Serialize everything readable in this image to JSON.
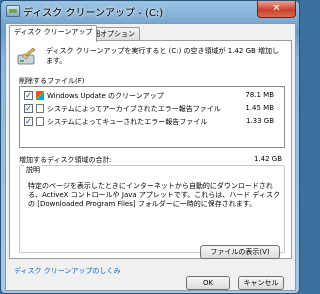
{
  "window": {
    "title": "ディスク クリーンアップ - (C:)",
    "close_glyph": "✕"
  },
  "tabs": [
    {
      "label": "ディスク クリーンアップ"
    },
    {
      "label": "詳細オプション"
    }
  ],
  "intro": {
    "text": "ディスク クリーンアップを実行すると (C:) の空き領域が 1.42 GB 増加します。"
  },
  "files_label": "削除するファイル(F)",
  "files": [
    {
      "checked": true,
      "icon": "windows-update-icon",
      "name": "Windows Update のクリーンアップ",
      "size": "78.1 MB",
      "check_glyph": "✓"
    },
    {
      "checked": true,
      "icon": "file-icon",
      "name": "システムによってアーカイブされたエラー報告ファイル",
      "size": "1.45 MB",
      "check_glyph": "✓"
    },
    {
      "checked": true,
      "icon": "file-icon",
      "name": "システムによってキューされたエラー報告ファイル",
      "size": "1.33 GB",
      "check_glyph": "✓"
    }
  ],
  "total": {
    "label": "増加するディスク領域の合計:",
    "value": "1.42 GB"
  },
  "description": {
    "legend": "説明",
    "text": "特定のページを表示したときにインターネットから自動的にダウンロードされる、ActiveX コントロールや Java アプレットです。これらは、ハード ディスクの [Downloaded Program Files] フォルダーに一時的に保存されます。",
    "view_button": "ファイルの表示(V)"
  },
  "footer": {
    "link": "ディスク クリーンアップのしくみ",
    "ok": "OK",
    "cancel": "キャンセル"
  }
}
